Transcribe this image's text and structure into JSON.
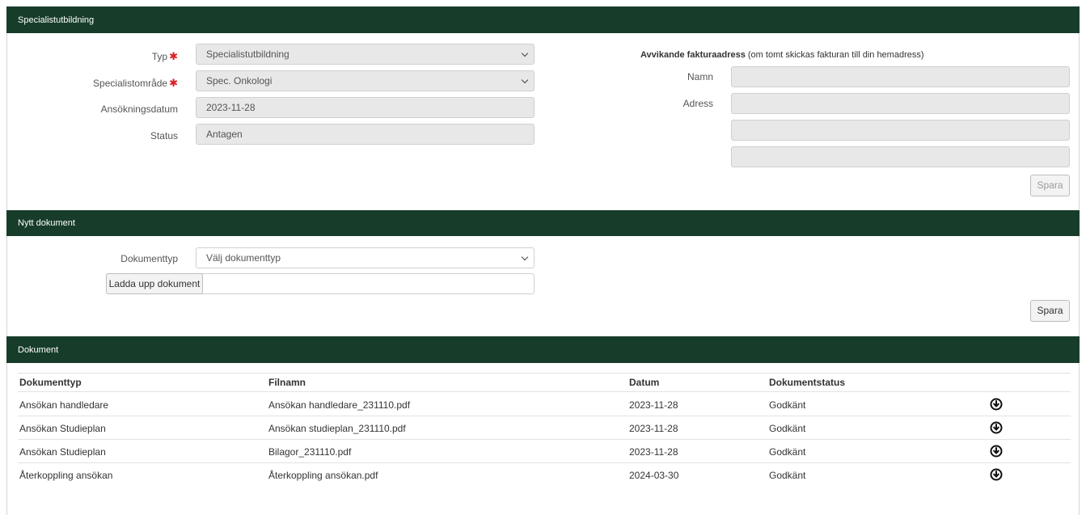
{
  "sections": {
    "specialist": "Specialistutbildning",
    "new_document": "Nytt dokument",
    "documents": "Dokument"
  },
  "form": {
    "typ_label": "Typ",
    "typ_value": "Specialistutbildning",
    "omrade_label": "Specialistområde",
    "omrade_value": "Spec. Onkologi",
    "datum_label": "Ansökningsdatum",
    "datum_value": "2023-11-28",
    "status_label": "Status",
    "status_value": "Antagen",
    "required_mark": "✱"
  },
  "invoice": {
    "title": "Avvikande fakturaadress",
    "hint": "(om tomt skickas fakturan till din hemadress)",
    "name_label": "Namn",
    "address_label": "Adress",
    "name_value": "",
    "address_line1": "",
    "address_line2": "",
    "address_line3": "",
    "save_label": "Spara"
  },
  "upload": {
    "doctype_label": "Dokumenttyp",
    "doctype_placeholder": "Välj dokumenttyp",
    "upload_button": "Ladda upp dokument",
    "file_value": "",
    "save_label": "Spara"
  },
  "table": {
    "columns": [
      "Dokumenttyp",
      "Filnamn",
      "Datum",
      "Dokumentstatus"
    ],
    "rows": [
      {
        "type": "Ansökan handledare",
        "file": "Ansökan handledare_231110.pdf",
        "date": "2023-11-28",
        "status": "Godkänt"
      },
      {
        "type": "Ansökan Studieplan",
        "file": "Ansökan studieplan_231110.pdf",
        "date": "2023-11-28",
        "status": "Godkänt"
      },
      {
        "type": "Ansökan Studieplan",
        "file": "Bilagor_231110.pdf",
        "date": "2023-11-28",
        "status": "Godkänt"
      },
      {
        "type": "Återkoppling ansökan",
        "file": "Återkoppling ansökan.pdf",
        "date": "2024-03-30",
        "status": "Godkänt"
      }
    ],
    "row_icon": "download-circle-icon"
  },
  "colors": {
    "header_band": "#173d2a",
    "required": "#d81f26"
  }
}
